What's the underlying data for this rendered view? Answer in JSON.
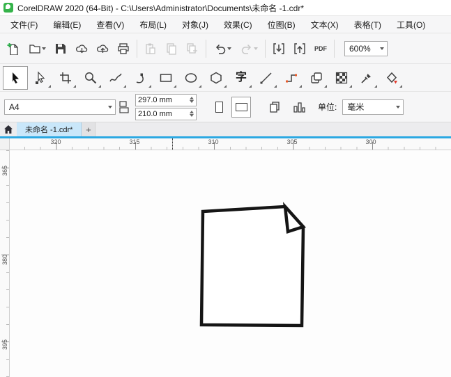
{
  "window": {
    "title": "CorelDRAW 2020 (64-Bit) - C:\\Users\\Administrator\\Documents\\未命名 -1.cdr*"
  },
  "menu": {
    "items": [
      "文件(F)",
      "编辑(E)",
      "查看(V)",
      "布局(L)",
      "对象(J)",
      "效果(C)",
      "位图(B)",
      "文本(X)",
      "表格(T)",
      "工具(O)"
    ]
  },
  "toolbar": {
    "zoom_value": "600%",
    "pdf_label": "PDF"
  },
  "toolbox": {
    "text_tool_glyph": "字"
  },
  "property_bar": {
    "page_size": "A4",
    "width_value": "297.0 mm",
    "height_value": "210.0 mm",
    "units_label": "单位:",
    "units_value": "毫米"
  },
  "tabbar": {
    "active_tab": "未命名 -1.cdr*",
    "new_tab_label": "+"
  },
  "rulers": {
    "horizontal": [
      "320",
      "315",
      "310",
      "305",
      "300"
    ],
    "vertical": [
      "365",
      "380",
      "395"
    ]
  }
}
